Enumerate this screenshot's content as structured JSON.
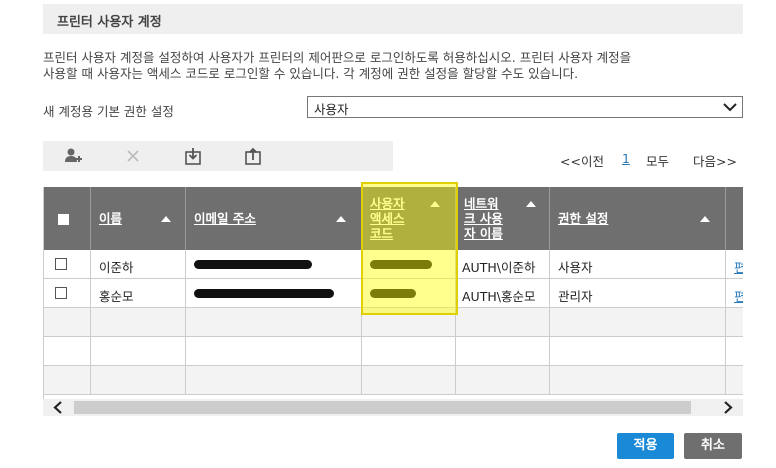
{
  "section": {
    "title": "프린터 사용자 계정"
  },
  "description": {
    "line1": "프린터 사용자 계정을 설정하여 사용자가 프린터의 제어판으로 로그인하도록 허용하십시오. 프린터 사용자 계정을",
    "line2": "사용할 때 사용자는 액세스 코드로 로그인할 수 있습니다. 각 계정에 권한 설정을 할당할 수도 있습니다."
  },
  "default_permission": {
    "label": "새 계정용 기본 권한 설정",
    "selected": "사용자"
  },
  "toolbar": {
    "icons": [
      "add-user-icon",
      "delete-icon",
      "import-icon",
      "export-icon"
    ]
  },
  "pager": {
    "prev": "<<이전",
    "current": "1",
    "all": "모두",
    "next": "다음>>"
  },
  "table": {
    "headers": {
      "name": "이름",
      "email": "이메일 주소",
      "access_code": [
        "사용자",
        "액세스",
        "코드"
      ],
      "network_user": [
        "네트워",
        "크 사용",
        "자 이름"
      ],
      "permission": "권한 설정"
    },
    "rows": [
      {
        "name": "이준하",
        "network_user": "AUTH\\이준하",
        "permission": "사용자",
        "edit": "편"
      },
      {
        "name": "홍순모",
        "network_user": "AUTH\\홍순모",
        "permission": "관리자",
        "edit": "편"
      }
    ]
  },
  "buttons": {
    "apply": "적용",
    "cancel": "취소"
  },
  "colors": {
    "accent": "#1a8ad6",
    "header_bg": "#6f6f6f",
    "highlight": "#ffff00"
  }
}
